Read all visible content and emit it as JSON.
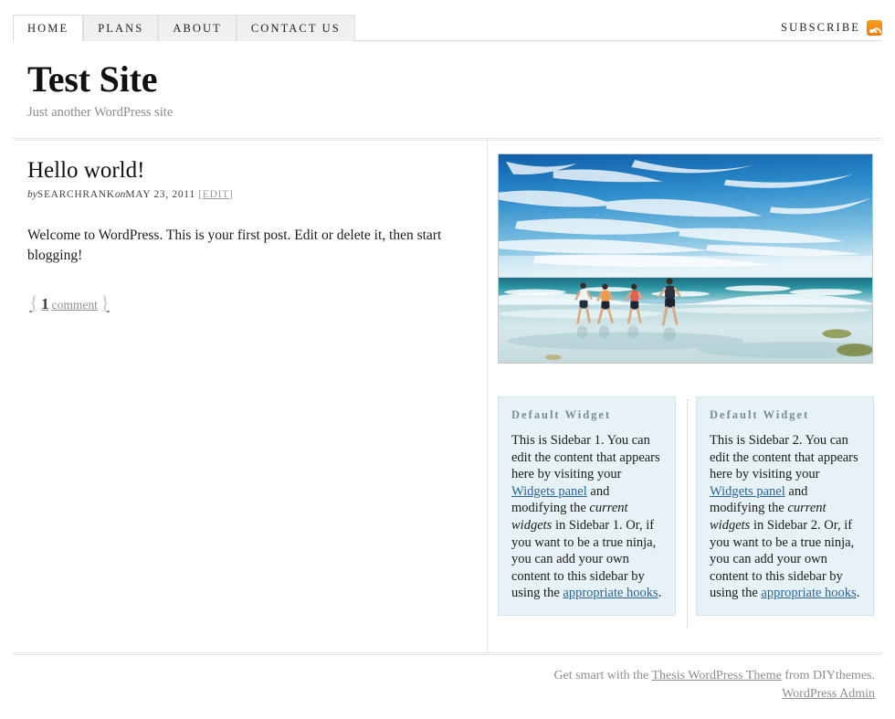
{
  "nav": {
    "items": [
      {
        "label": "HOME",
        "active": true
      },
      {
        "label": "PLANS",
        "active": false
      },
      {
        "label": "ABOUT",
        "active": false
      },
      {
        "label": "CONTACT US",
        "active": false
      }
    ],
    "subscribe_label": "SUBSCRIBE",
    "rss_icon": "rss-feed-icon",
    "rss_color": "#f58410"
  },
  "header": {
    "site_title": "Test Site",
    "tagline": "Just another WordPress site"
  },
  "post": {
    "title": "Hello world!",
    "byline_by": "by",
    "byline_author": "SEARCHRANK",
    "byline_on": "on",
    "byline_date": "MAY 23, 2011",
    "edit_open": "[",
    "edit_label": "EDIT",
    "edit_close": "]",
    "body": "Welcome to WordPress. This is your first post. Edit or delete it, then start blogging!",
    "comment_brace_open": "{",
    "comment_count": "1",
    "comment_word": "comment",
    "comment_brace_close": "}"
  },
  "feature_image": {
    "name": "beach-runners-photo",
    "description": "Four runners jogging along a wet beach at the shoreline under a blue sky with wispy cirrus clouds",
    "sky_color": "#1a7fc1",
    "ocean_color": "#1f7f8c",
    "sand_color": "#cfe3e6"
  },
  "sidebars": [
    {
      "title": "Default Widget",
      "text_1": "This is Sidebar 1. You can edit the content that appears here by visiting your ",
      "link_1": "Widgets panel",
      "text_2": " and modifying the ",
      "em_1": "current widgets",
      "text_3": " in Sidebar 1. Or, if you want to be a true ninja, you can add your own content to this sidebar by using the ",
      "link_2": "appropriate hooks",
      "text_4": "."
    },
    {
      "title": "Default Widget",
      "text_1": "This is Sidebar 2. You can edit the content that appears here by visiting your ",
      "link_1": "Widgets panel",
      "text_2": " and modifying the ",
      "em_1": "current widgets",
      "text_3": " in Sidebar 2. Or, if you want to be a true ninja, you can add your own content to this sidebar by using the ",
      "link_2": "appropriate hooks",
      "text_4": "."
    }
  ],
  "footer": {
    "line1_pre": "Get smart with the ",
    "line1_link": "Thesis WordPress Theme",
    "line1_post": " from DIYthemes.",
    "line2_link": "WordPress Admin"
  },
  "theme": {
    "link_color": "#2a6496",
    "widget_bg": "#e7f2f6",
    "widget_border": "#cfe3ea",
    "muted_text": "#8d8d8d"
  }
}
